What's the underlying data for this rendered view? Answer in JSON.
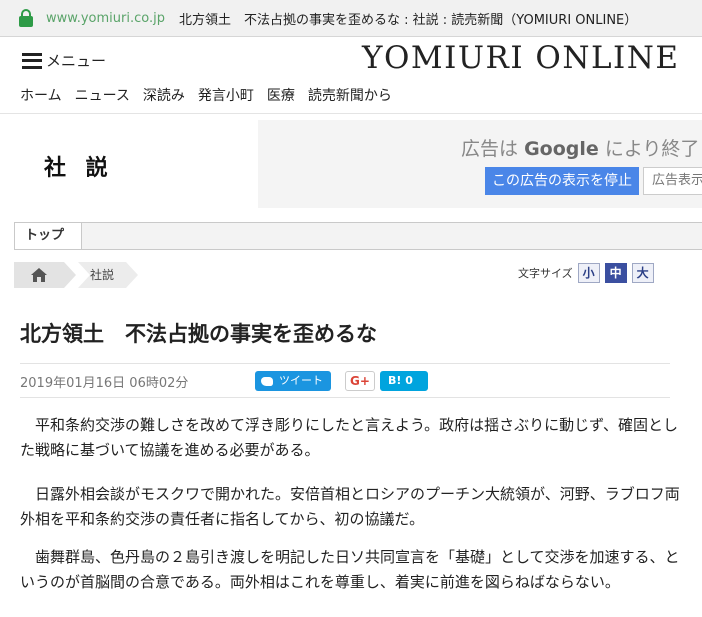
{
  "browser": {
    "domain": "www.yomiuri.co.jp",
    "title": "北方領土　不法占拠の事実を歪めるな : 社説 : 読売新聞（YOMIURI ONLINE）"
  },
  "header": {
    "menu_label": "メニュー",
    "logo": "YOMIURI ONLINE",
    "nav": [
      "ホーム",
      "ニュース",
      "深読み",
      "発言小町",
      "医療",
      "読売新聞から"
    ]
  },
  "section": {
    "title": "社 説"
  },
  "ad": {
    "message_prefix": "広告は",
    "message_brand": "Google",
    "message_suffix": "により終了",
    "stop_button": "この広告の表示を停止",
    "settings_button": "広告表示設定"
  },
  "tabs": {
    "top": "トップ"
  },
  "breadcrumb": {
    "category": "社説"
  },
  "font_size": {
    "label": "文字サイズ",
    "small": "小",
    "medium": "中",
    "large": "大"
  },
  "article": {
    "headline": "北方領土　不法占拠の事実を歪めるな",
    "date": "2019年01月16日 06時02分",
    "tweet_label": "ツイート",
    "gplus_label": "G+",
    "hatena_label": "B! 0",
    "paragraphs": [
      "　平和条約交渉の難しさを改めて浮き彫りにしたと言えよう。政府は揺さぶりに動じず、確固とした戦略に基づいて協議を進める必要がある。",
      "　日露外相会談がモスクワで開かれた。安倍首相とロシアのプーチン大統領が、河野、ラブロフ両外相を平和条約交渉の責任者に指名してから、初の協議だ。",
      "　歯舞群島、色丹島の２島引き渡しを明記した日ソ共同宣言を「基礎」として交渉を加速する、というのが首脳間の合意である。両外相はこれを尊重し、着実に前進を図らねばならない。"
    ]
  }
}
